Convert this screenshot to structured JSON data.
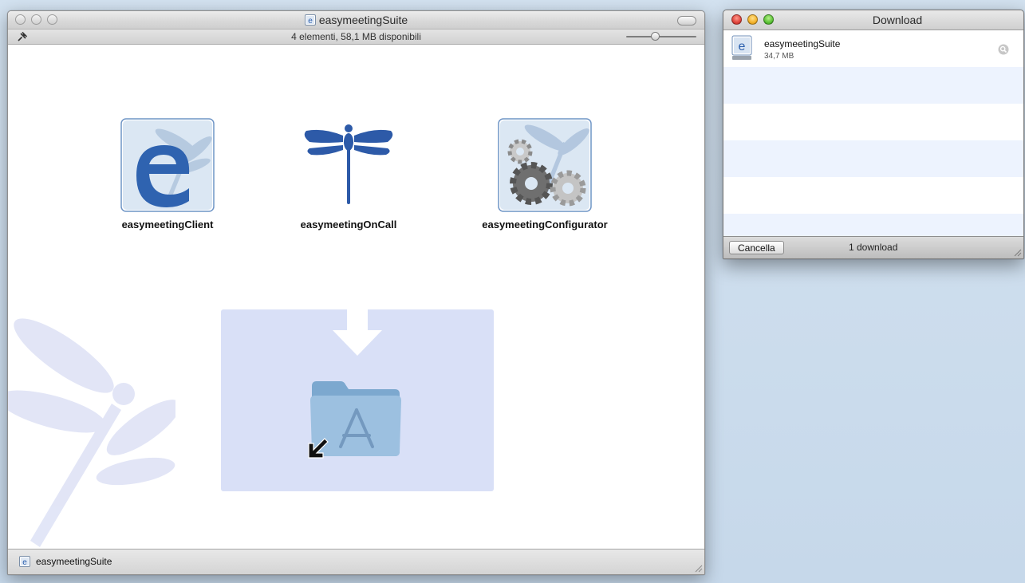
{
  "finder": {
    "title": "easymeetingSuite",
    "status": "4 elementi, 58,1 MB disponibili",
    "icon_size_slider": 0.4,
    "items": [
      {
        "label": "easymeetingClient"
      },
      {
        "label": "easymeetingOnCall"
      },
      {
        "label": "easymeetingConfigurator"
      }
    ],
    "drop_target": {
      "label": "Applications alias"
    },
    "footer": "easymeetingSuite"
  },
  "download": {
    "title": "Download",
    "items": [
      {
        "name": "easymeetingSuite",
        "size": "34,7 MB"
      }
    ],
    "cancel_label": "Cancella",
    "count": "1 download"
  },
  "colors": {
    "desktop": "#cbdcee",
    "drop_zone": "#d9e0f7",
    "brand_blue": "#2b5fad",
    "stripe": "#edf3fe"
  }
}
